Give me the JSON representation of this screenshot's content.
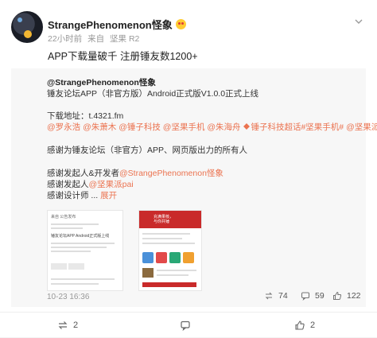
{
  "post": {
    "username": "StrangePhenomenon怪象",
    "time": "22小时前",
    "source_prefix": "来自",
    "source_device": "坚果 R2",
    "text": "APP下载量破千 注册锤友数1200+"
  },
  "quote": {
    "author": "@StrangePhenomenon怪象",
    "title": "锤友论坛APP（非官方版）Android正式版V1.0.0正式上线",
    "download_label": "下载地址：",
    "download_link": "t.4321.fm",
    "mentions": [
      "@罗永浩",
      "@朱萧木",
      "@锤子科技",
      "@坚果手机",
      "@朱海舟",
      "锤子科技超话",
      "#坚果手机#",
      "@坚果派pai"
    ],
    "thanks_line": "感谢为锤友论坛（非官方）APP、网页版出力的所有人",
    "initiator_prefix": "感谢发起人&开发者",
    "initiator_link": "@StrangePhenomenon怪象",
    "sponsor_prefix": "感谢发起人",
    "sponsor_link": "@坚果派pai",
    "designer_prefix": "感谢设计师 ...",
    "expand": "展开",
    "time": "10-23 16:36",
    "stats": {
      "reposts": "74",
      "comments": "59",
      "likes": "122"
    },
    "img1": {
      "header": "来自 公告发布",
      "title": "锤友论坛APP Android正式版上线"
    },
    "img2": {
      "banner_l1": "充满果核，",
      "banner_l2": "与你共锤"
    }
  },
  "toolbar": {
    "reposts": "2",
    "comments": "",
    "likes": "2"
  },
  "colors": {
    "accent": "#eb7350",
    "red": "#c92a2a"
  }
}
